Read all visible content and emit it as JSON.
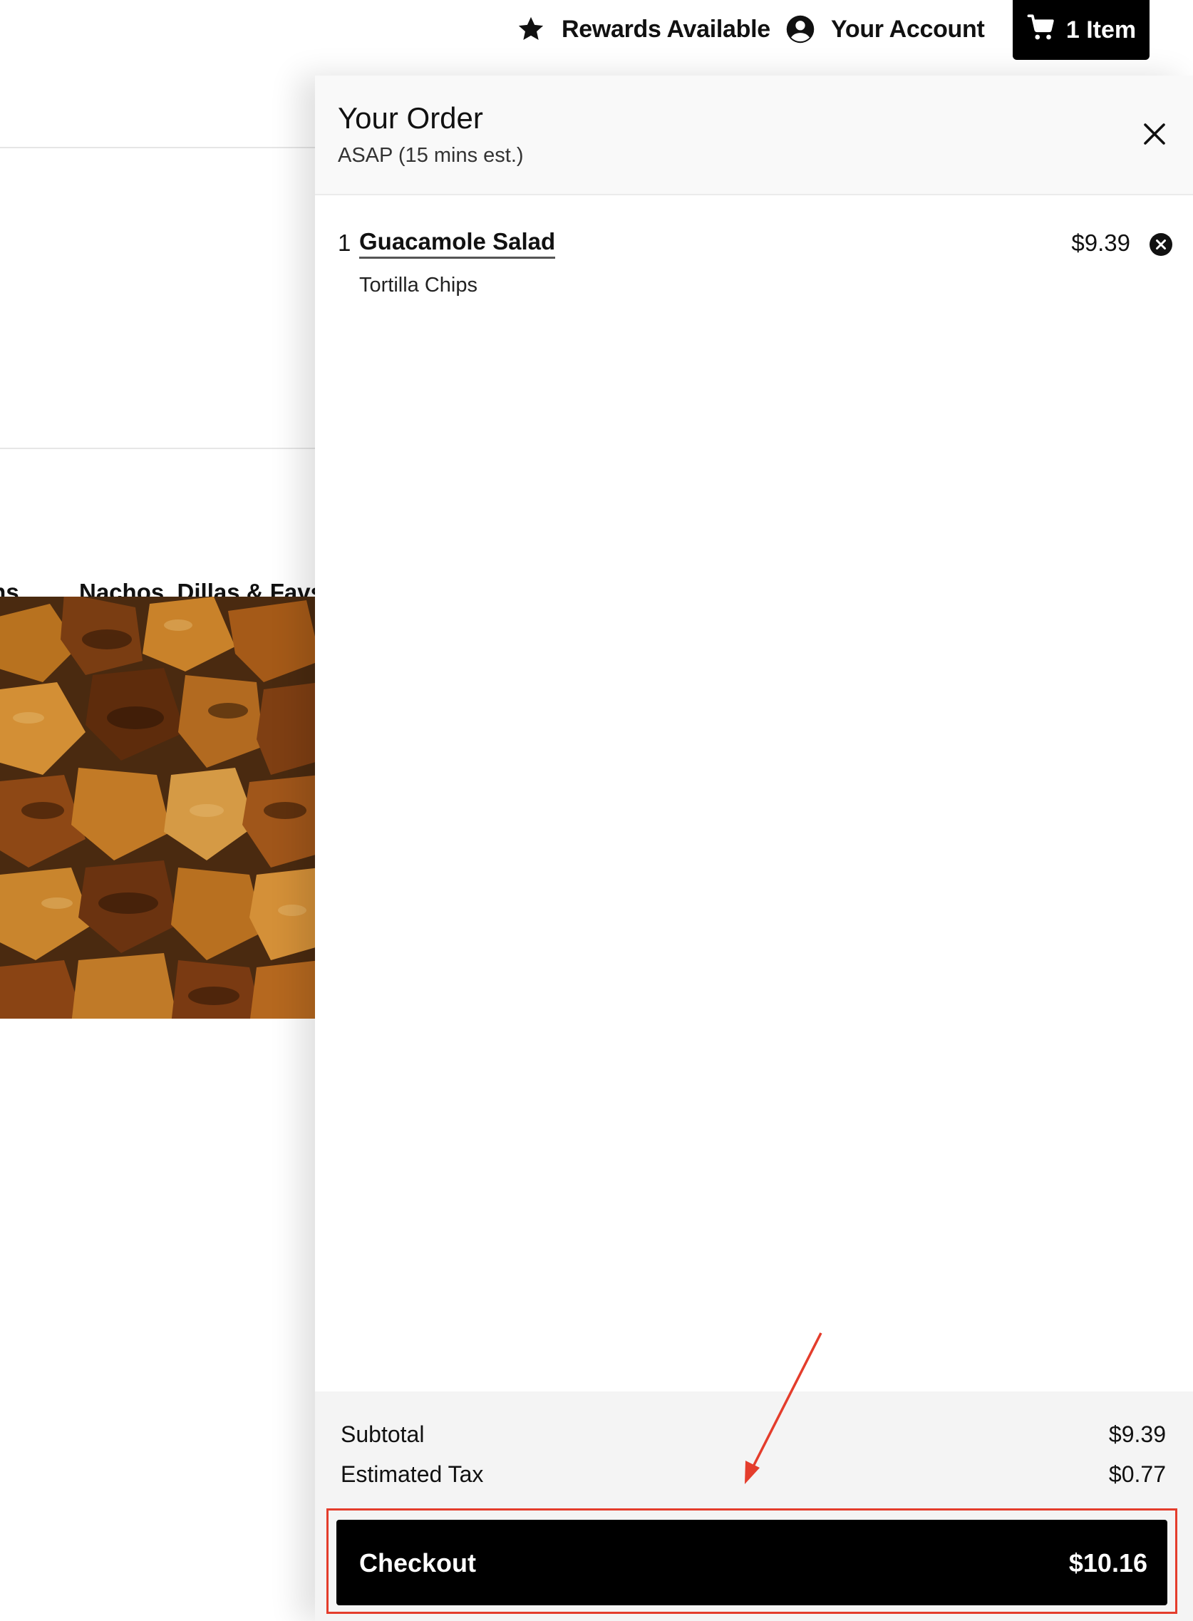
{
  "header": {
    "rewards_label": "Rewards Available",
    "account_label": "Your Account",
    "cart_label": "1 Item"
  },
  "background": {
    "menu_tabs": [
      {
        "label": "ons"
      },
      {
        "label": "Nachos, Dillas & Favs"
      }
    ],
    "food_image_icon": "food-photo"
  },
  "order": {
    "title": "Your Order",
    "subtitle": "ASAP (15 mins est.)",
    "items": [
      {
        "quantity": "1",
        "name": "Guacamole Salad",
        "modifier": "Tortilla Chips",
        "price": "$9.39"
      }
    ],
    "summary": {
      "subtotal_label": "Subtotal",
      "subtotal_value": "$9.39",
      "tax_label": "Estimated Tax",
      "tax_value": "$0.77"
    },
    "checkout": {
      "label": "Checkout",
      "total": "$10.16"
    }
  },
  "colors": {
    "primary": "#000000",
    "annotation": "#e43d2c",
    "footer_bg": "#f4f4f4"
  }
}
